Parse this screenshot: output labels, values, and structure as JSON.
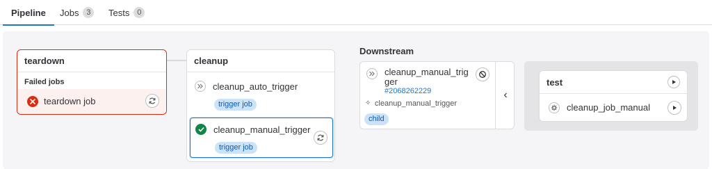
{
  "tabs": [
    {
      "label": "Pipeline",
      "count": null,
      "active": true
    },
    {
      "label": "Jobs",
      "count": "3"
    },
    {
      "label": "Tests",
      "count": "0"
    }
  ],
  "stages": {
    "teardown": {
      "title": "teardown",
      "group_label": "Failed jobs",
      "jobs": [
        {
          "name": "teardown job",
          "status": "failed",
          "action": "retry"
        }
      ]
    },
    "cleanup": {
      "title": "cleanup",
      "jobs": [
        {
          "name": "cleanup_auto_trigger",
          "status": "skipped",
          "badge": "trigger job"
        },
        {
          "name": "cleanup_manual_trigger",
          "status": "success",
          "badge": "trigger job",
          "action": "retry"
        }
      ]
    }
  },
  "downstream": {
    "heading": "Downstream",
    "pipeline": {
      "name_line1": "cleanup_manual_trig",
      "name_line2": "ger",
      "id": "#2068262229",
      "source_job": "cleanup_manual_trigger",
      "badge": "child",
      "action": "cancel"
    },
    "collapse_glyph": "‹"
  },
  "child_pipeline": {
    "stage_title": "test",
    "jobs": [
      {
        "name": "cleanup_job_manual",
        "status": "manual",
        "action": "play"
      }
    ]
  },
  "colors": {
    "accent": "#1f75cb",
    "failed": "#dd2b0e",
    "success": "#108548",
    "failed_bg": "#fcf1ef",
    "badge_bg": "#cbe2f9",
    "badge_fg": "#0b5cad"
  }
}
